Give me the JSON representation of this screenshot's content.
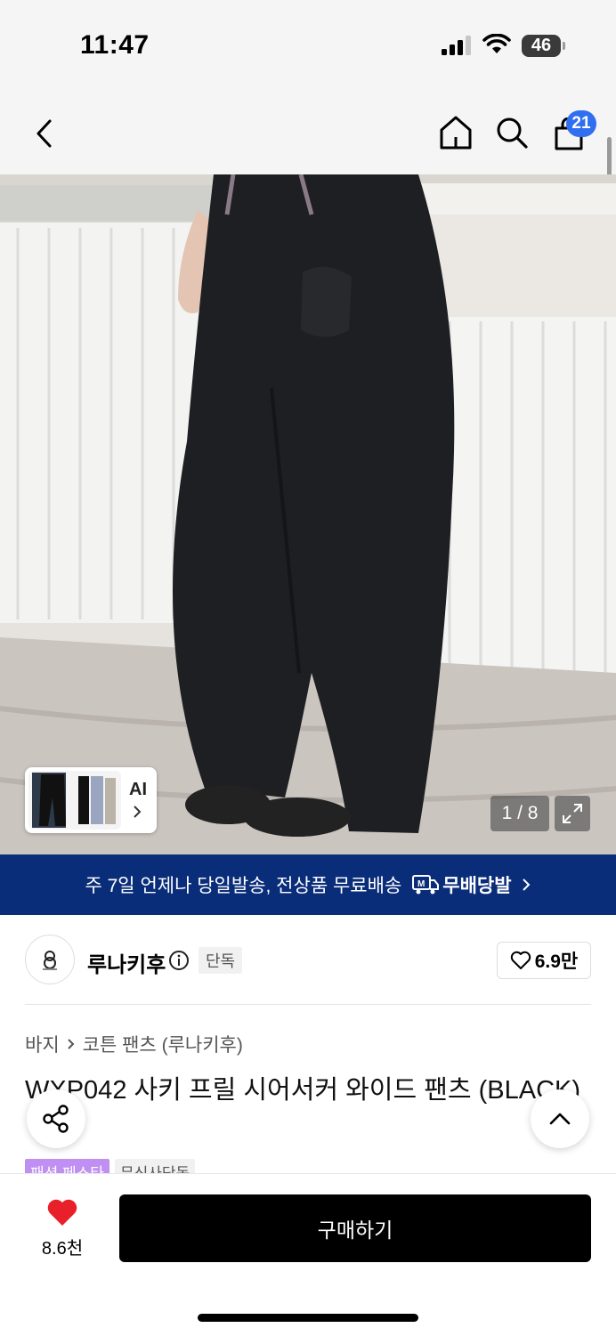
{
  "status_bar": {
    "time": "11:47",
    "battery": "46"
  },
  "nav": {
    "cart_count": "21",
    "icons": [
      "back-icon",
      "home-icon",
      "search-icon",
      "cart-icon"
    ]
  },
  "gallery": {
    "ai_label": "AI",
    "page_counter": "1 / 8"
  },
  "shipping_banner": {
    "text": "주 7일 언제나 당일발송, 전상품 무료배송",
    "brand": "무배당발",
    "brand_badge": "M"
  },
  "brand": {
    "name": "루나키후",
    "exclusive_tag": "단독",
    "likes": "6.9만"
  },
  "breadcrumb": {
    "category": "바지",
    "subcategory": "코튼 팬츠 (루나키후)"
  },
  "product": {
    "title": "WXP042 사키 프릴 시어서커 와이드 팬츠 (BLACK)",
    "tags": [
      "패션 페스타",
      "무신사단독"
    ]
  },
  "bottom_bar": {
    "wish_count": "8.6천",
    "buy_label": "구매하기"
  },
  "colors": {
    "banner": "#0a2d7a",
    "cart_badge": "#2f6ff0",
    "wish_heart": "#e8202a",
    "festa_tag": "#c08ff2"
  }
}
